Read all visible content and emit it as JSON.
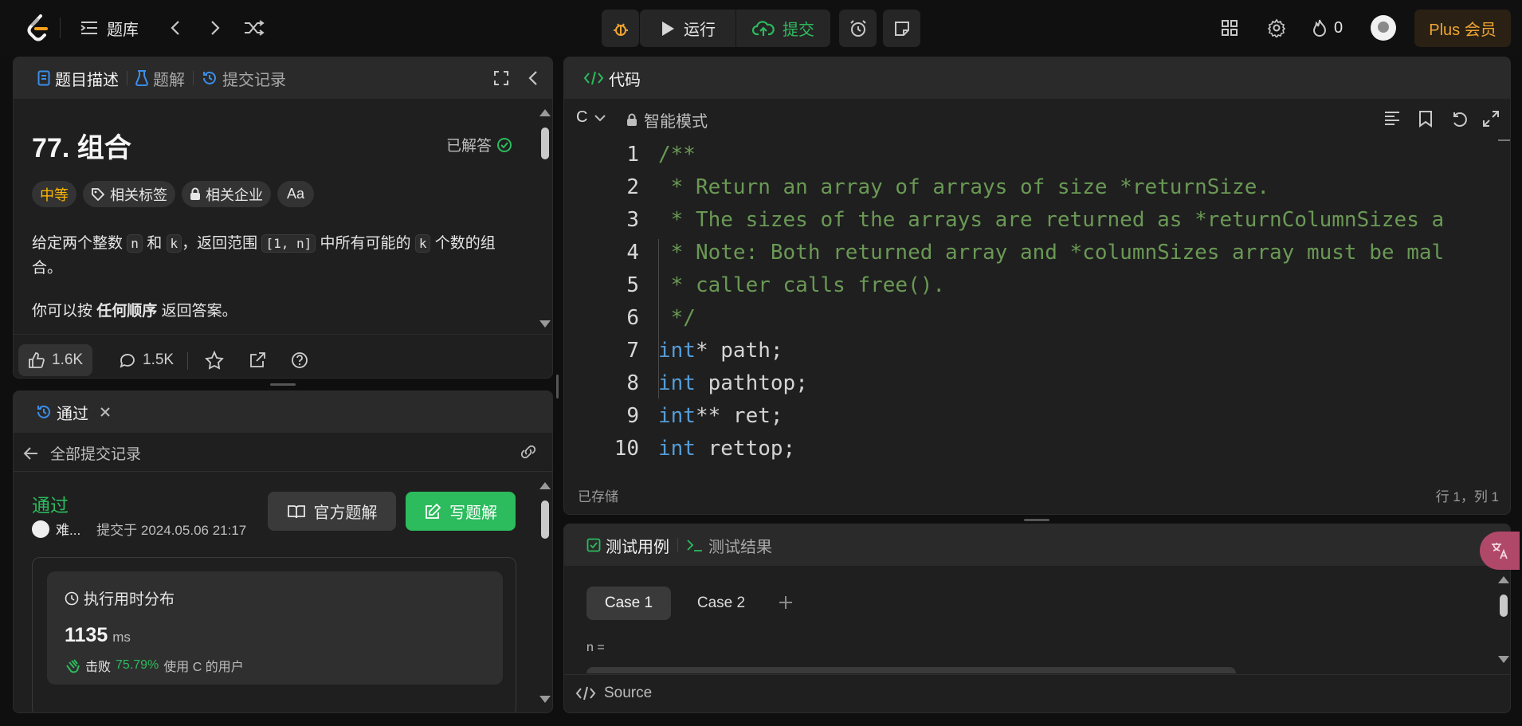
{
  "topbar": {
    "problem_list_label": "题库",
    "run_label": "运行",
    "submit_label": "提交",
    "streak_count": "0",
    "plus_label": "Plus 会员"
  },
  "description": {
    "tabs": [
      "题目描述",
      "题解",
      "提交记录"
    ],
    "title": "77. 组合",
    "solved_label": "已解答",
    "difficulty": "中等",
    "tags": [
      "相关标签",
      "相关企业"
    ],
    "font_tag": "Aa",
    "text": {
      "p1_a": "给定两个整数",
      "code_n": "n",
      "p1_b": "和",
      "code_k": "k",
      "p1_c": "，返回范围",
      "code_range": "[1, n]",
      "p1_d": "中所有可能的",
      "code_k2": "k",
      "p1_e": "个数的组合。",
      "p2_a": "你可以按",
      "p2_bold": "任何顺序",
      "p2_b": "返回答案。"
    },
    "likes": "1.6K",
    "comments": "1.5K"
  },
  "submission": {
    "tab_label": "通过",
    "back_label": "全部提交记录",
    "status": "通过",
    "user": "难...",
    "submitted_at": "提交于 2024.05.06 21:17",
    "official_solution_label": "官方题解",
    "write_solution_label": "写题解",
    "runtime_title": "执行用时分布",
    "runtime_value": "1135",
    "runtime_unit": "ms",
    "beat_prefix": "击败",
    "beat_percent": "75.79%",
    "beat_suffix": "使用 C 的用户"
  },
  "editor": {
    "tab_label": "代码",
    "language": "C",
    "mode_label": "智能模式",
    "lines": [
      {
        "n": "1",
        "parts": [
          {
            "t": "/**",
            "c": "c-comment"
          }
        ]
      },
      {
        "n": "2",
        "parts": [
          {
            "t": " * Return an array of arrays of size *returnSize.",
            "c": "c-comment"
          }
        ]
      },
      {
        "n": "3",
        "parts": [
          {
            "t": " * The sizes of the arrays are returned as *returnColumnSizes a",
            "c": "c-comment"
          }
        ]
      },
      {
        "n": "4",
        "parts": [
          {
            "t": " * Note: Both returned array and *columnSizes array must be mal",
            "c": "c-comment"
          }
        ]
      },
      {
        "n": "5",
        "parts": [
          {
            "t": " * caller calls free().",
            "c": "c-comment"
          }
        ]
      },
      {
        "n": "6",
        "parts": [
          {
            "t": " */",
            "c": "c-comment"
          }
        ]
      },
      {
        "n": "7",
        "parts": [
          {
            "t": "int",
            "c": "c-kw"
          },
          {
            "t": "* path;",
            "c": "c-plain"
          }
        ]
      },
      {
        "n": "8",
        "parts": [
          {
            "t": "int",
            "c": "c-kw"
          },
          {
            "t": " pathtop;",
            "c": "c-plain"
          }
        ]
      },
      {
        "n": "9",
        "parts": [
          {
            "t": "int",
            "c": "c-kw"
          },
          {
            "t": "** ret;",
            "c": "c-plain"
          }
        ]
      },
      {
        "n": "10",
        "parts": [
          {
            "t": "int",
            "c": "c-kw"
          },
          {
            "t": " rettop;",
            "c": "c-plain"
          }
        ]
      }
    ],
    "saved_label": "已存储",
    "cursor_pos": "行 1，列 1"
  },
  "testcase": {
    "tabs": [
      "测试用例",
      "测试结果"
    ],
    "cases": [
      "Case 1",
      "Case 2"
    ],
    "param_label": "n =",
    "source_label": "Source"
  },
  "colors": {
    "accent_green": "#2cbb5d",
    "medium_orange": "#ffb800",
    "plus_gold": "#f0a533"
  }
}
